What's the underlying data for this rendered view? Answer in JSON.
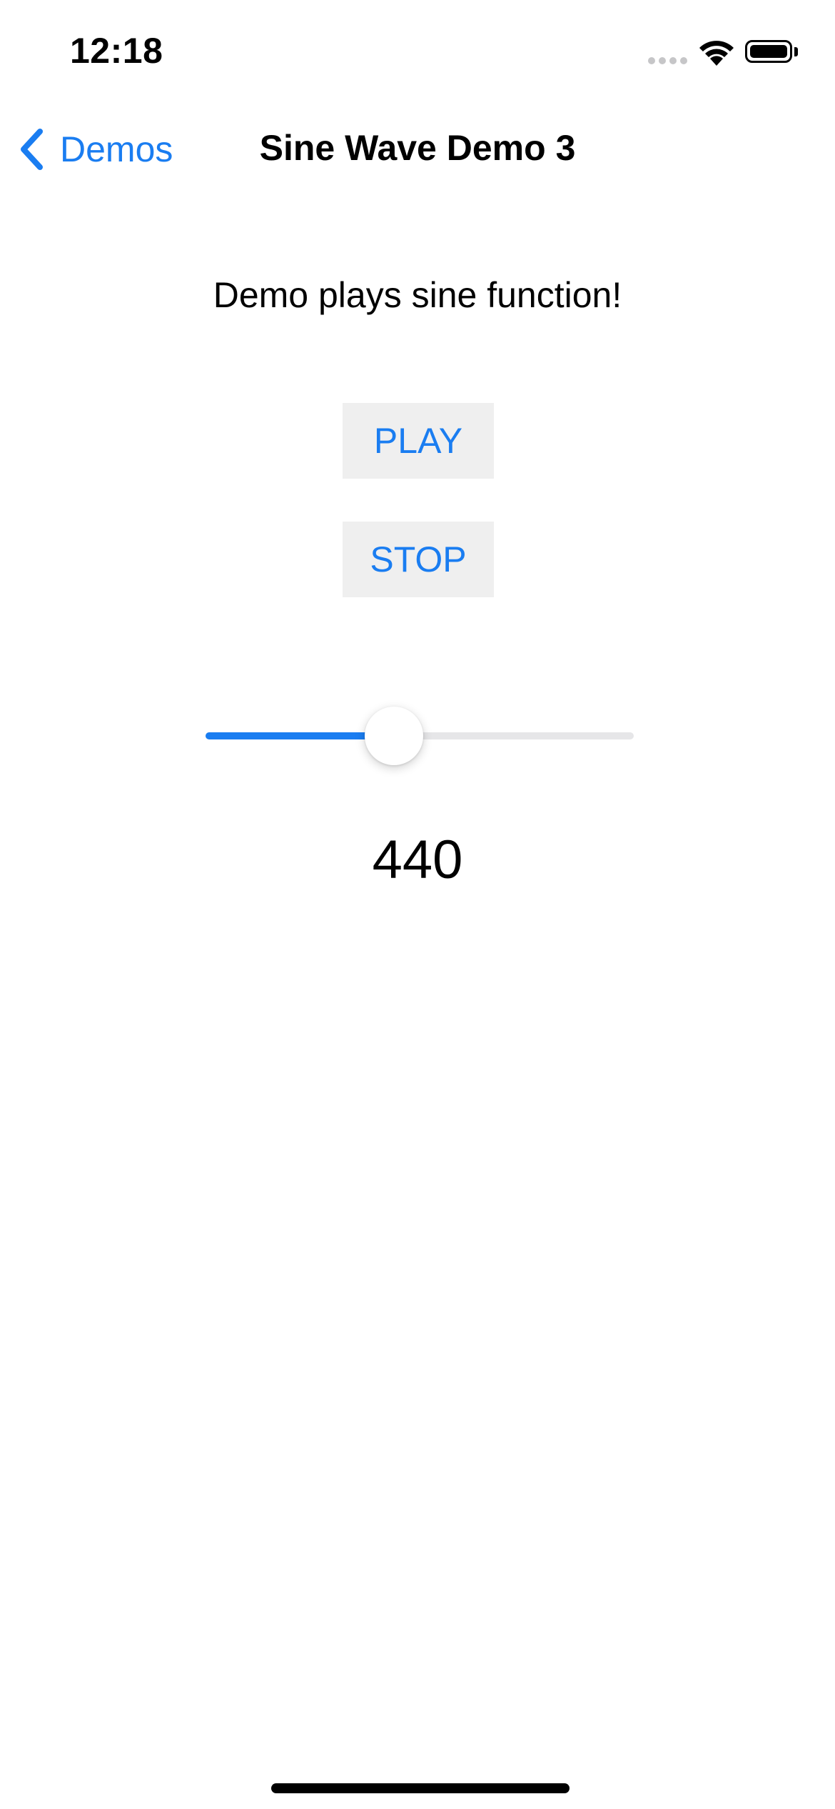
{
  "status_bar": {
    "time": "12:18",
    "icons": [
      "cellular-signal-icon",
      "wifi-icon",
      "battery-icon"
    ]
  },
  "nav": {
    "back_label": "Demos",
    "back_icon": "chevron-left-icon",
    "title": "Sine Wave Demo 3"
  },
  "content": {
    "description": "Demo plays sine function!",
    "play_label": "PLAY",
    "stop_label": "STOP",
    "slider": {
      "position_fraction": 0.44
    },
    "value": "440"
  },
  "colors": {
    "accent": "#1a7df1",
    "button_background": "#efefef",
    "track_inactive": "#e6e6e8",
    "text": "#000000",
    "background": "#ffffff"
  }
}
